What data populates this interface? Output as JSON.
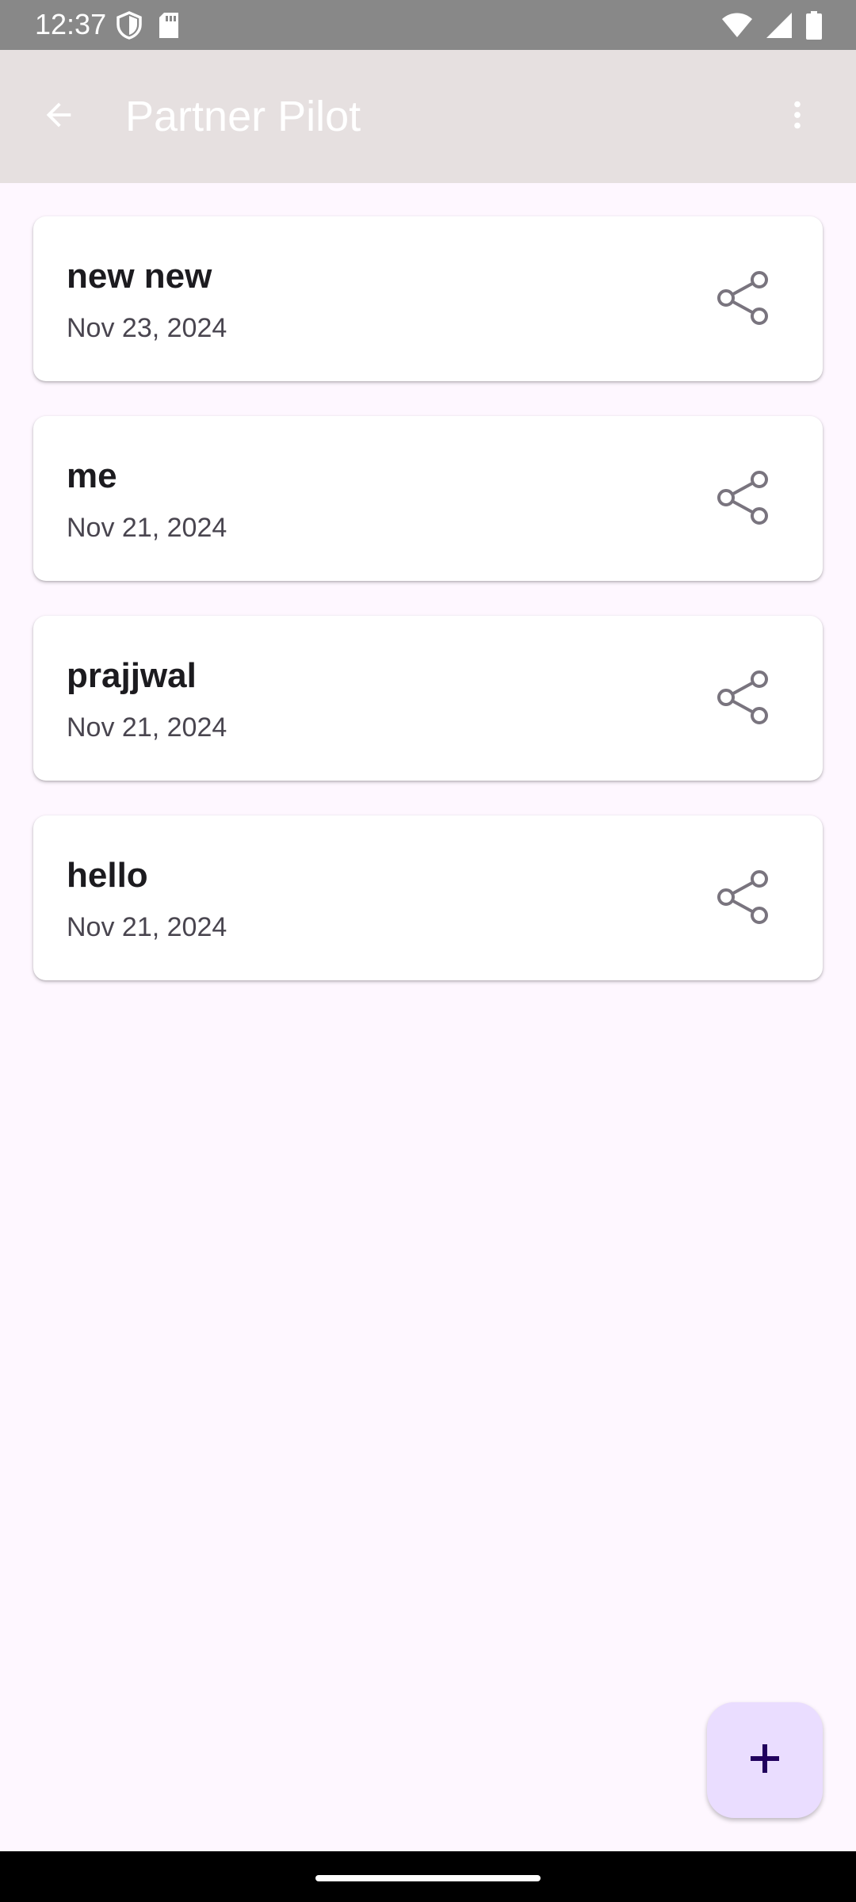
{
  "status_bar": {
    "time": "12:37",
    "left_icons": [
      "shield-icon",
      "sd-card-icon"
    ],
    "right_icons": [
      "wifi-icon",
      "cell-signal-icon",
      "battery-icon"
    ]
  },
  "app_bar": {
    "title": "Partner Pilot",
    "back_icon": "arrow-back-icon",
    "menu_icon": "more-vert-icon",
    "background": "#E6E0E0"
  },
  "items": [
    {
      "title": "new new",
      "date": "Nov 23, 2024"
    },
    {
      "title": "me",
      "date": "Nov 21, 2024"
    },
    {
      "title": "prajjwal",
      "date": "Nov 21, 2024"
    },
    {
      "title": "hello",
      "date": "Nov 21, 2024"
    }
  ],
  "fab": {
    "icon": "plus-icon",
    "background": "#EADDFF",
    "icon_color": "#21005D"
  },
  "colors": {
    "page_background": "#FEF7FF",
    "status_bar": "#888888",
    "card_background": "#FFFFFF",
    "title_text": "#1C1B1F",
    "date_text": "#49454F",
    "share_icon": "#79747E"
  }
}
